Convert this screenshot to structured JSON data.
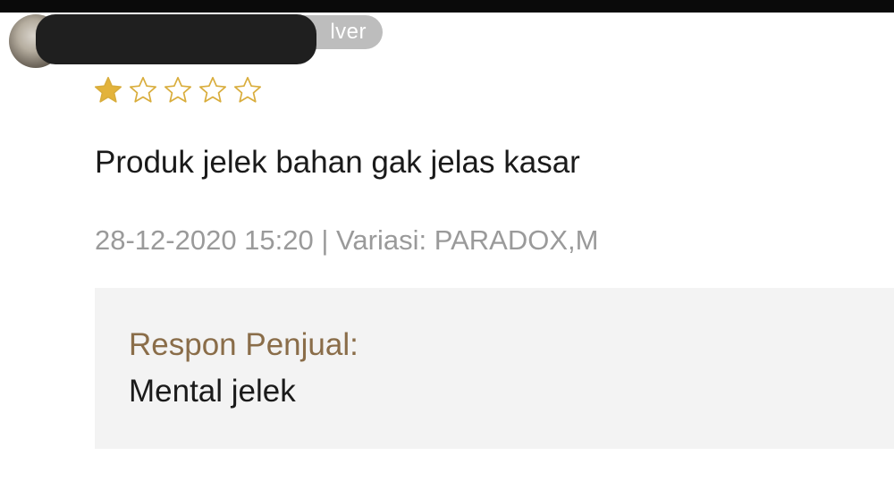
{
  "review": {
    "tier_badge": "lver",
    "rating": 1,
    "max_rating": 5,
    "text": "Produk jelek bahan gak jelas kasar",
    "meta": "28-12-2020 15:20 | Variasi: PARADOX,M"
  },
  "seller_response": {
    "label": "Respon Penjual:",
    "text": "Mental jelek"
  },
  "colors": {
    "star_filled": "#e3b33b",
    "star_outline": "#d9ad3c",
    "seller_label": "#8a6d49",
    "meta_text": "#9a9a9a",
    "response_bg": "#f3f3f3"
  }
}
